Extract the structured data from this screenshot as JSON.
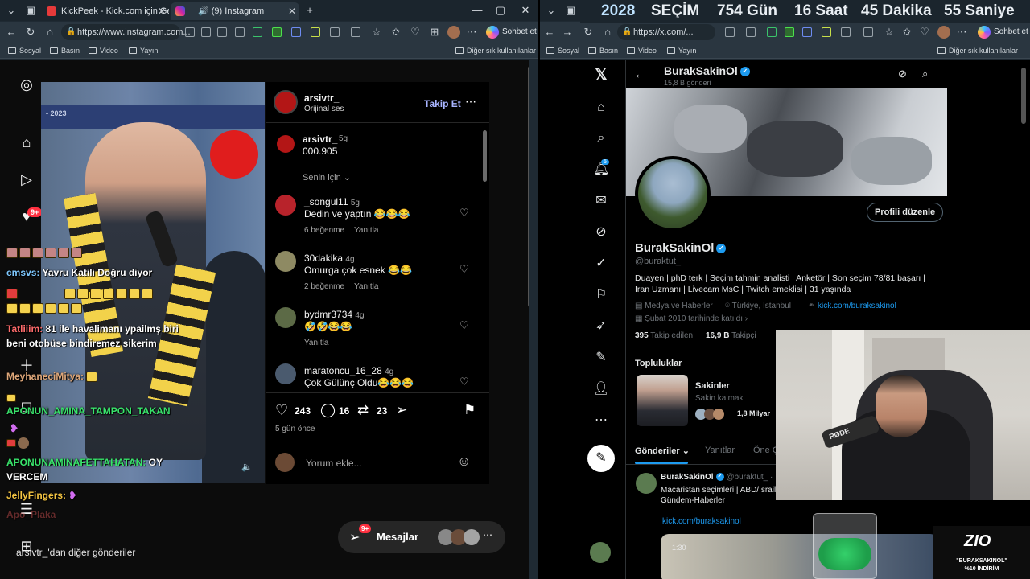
{
  "left_browser": {
    "tabs": [
      {
        "label": "KickPeek - Kick.com için Gerçek Za",
        "active": false
      },
      {
        "label": "(9) Instagram",
        "active": true
      }
    ],
    "new_tab": "+",
    "url": "https://www.instagram.com...",
    "copilot": "Sohbet et",
    "favorites": [
      "Sosyal",
      "Basın",
      "Video",
      "Yayın"
    ],
    "other_favorites": "Diğer sık kullanılanlar"
  },
  "right_browser": {
    "url": "https://x.com/...",
    "copilot": "Sohbet et",
    "favorites": [
      "Sosyal",
      "Basın",
      "Video",
      "Yayın"
    ],
    "other_favorites": "Diğer sık kullanılanlar"
  },
  "countdown": {
    "year": "2028",
    "label": "SEÇİM",
    "days": "754 Gün",
    "hours": "16 Saat",
    "minutes": "45 Dakika",
    "seconds": "55 Saniye"
  },
  "instagram": {
    "video": {
      "banner": "- 2023"
    },
    "post_author": "arsivtr_",
    "audio": "Orijinal ses",
    "follow": "Takip Et",
    "caption": {
      "user": "arsivtr_",
      "time": "5g",
      "text": "000.905"
    },
    "sort": "Senin için",
    "comments": [
      {
        "user": "_songul11",
        "time": "5g",
        "text": "Dedin ve yaptın 😂😂😂",
        "likes": "6 beğenme",
        "reply": "Yanıtla"
      },
      {
        "user": "30dakika",
        "time": "4g",
        "text": "Omurga çok esnek 😂😂",
        "likes": "2 beğenme",
        "reply": "Yanıtla"
      },
      {
        "user": "bydmr3734",
        "time": "4g",
        "text": "🤣🤣😂😂",
        "likes": "",
        "reply": "Yanıtla"
      },
      {
        "user": "maratoncu_16_28",
        "time": "4g",
        "text": "Çok Gülünç Oldu😂😂😂",
        "likes": "",
        "reply": ""
      }
    ],
    "stats": {
      "likes": "243",
      "comments": "16",
      "reposts": "23"
    },
    "posted": "5 gün önce",
    "comment_placeholder": "Yorum ekle...",
    "notif_badge": "9+",
    "messages": "Mesajlar",
    "msg_badge": "9+",
    "more_posts": "arsivtr_'dan diğer gönderiler"
  },
  "stream_chat": [
    {
      "user": "cmsvs:",
      "text": "Yavru Katili Doğru diyor",
      "color": "#7ec8ff"
    },
    {
      "user": "Tatliiim:",
      "text": "81 ile havalimanı ypailmş biri beni otobüse bindiremez sikerim",
      "color": "#ff6b6b"
    },
    {
      "user": "MeyhaneciMitya:",
      "text": "",
      "color": "#e0a87a"
    },
    {
      "user": "APONUN_AMINA_TAMPON_TAKAN",
      "text": "",
      "color": "#39e36b"
    },
    {
      "user": "APONUNAMINAFETTAHATAN:",
      "text": "OY VERCEM",
      "color": "#39e36b"
    },
    {
      "user": "JellyFingers:",
      "text": "",
      "color": "#f4c542"
    },
    {
      "user": "Apo_Plaka",
      "text": "",
      "color": "#d05050"
    }
  ],
  "x": {
    "header_name": "BurakSakinOl",
    "header_posts": "15,8 B gönderi",
    "edit_profile": "Profili düzenle",
    "name": "BurakSakinOl",
    "handle": "@buraktut_",
    "bio": "Duayen | phD terk | Seçim tahmin analisti | Anketör | Son seçim 78/81 başarı | İran Uzmanı | Livecam MsC | Twitch emeklisi | 31 yaşında",
    "category": "Medya ve Haberler",
    "location": "Türkiye, Istanbul",
    "link": "kick.com/buraksakinol",
    "joined": "Şubat 2010 tarihinde katıldı",
    "following_count": "395",
    "following_label": "Takip edilen",
    "followers_count": "16,9 B",
    "followers_label": "Takipçi",
    "communities_title": "Topluluklar",
    "community": {
      "name": "Sakinler",
      "sub": "Sakin kalmak",
      "members": "1,8 Milyar"
    },
    "tabs": [
      "Gönderiler",
      "Yanıtlar",
      "Öne Ç"
    ],
    "nav_badge": "5",
    "post": {
      "name": "BurakSakinOl",
      "handle": "@buraktut_ ·",
      "text": "Macaristan seçimleri | ABD/İsrail Gündem-Haberler",
      "link": "kick.com/buraksakinol",
      "duration": "1:30"
    }
  },
  "overlay": {
    "brand": "ZIO",
    "promo_line1": "\"BURAKSAKINOL\"",
    "promo_line2": "%10 İNDİRİM",
    "mic_label": "RØDE"
  },
  "colors": {
    "instagram_accent": "#a8b4ff",
    "x_blue": "#1d9bf0",
    "badge_red": "#ff3040"
  }
}
